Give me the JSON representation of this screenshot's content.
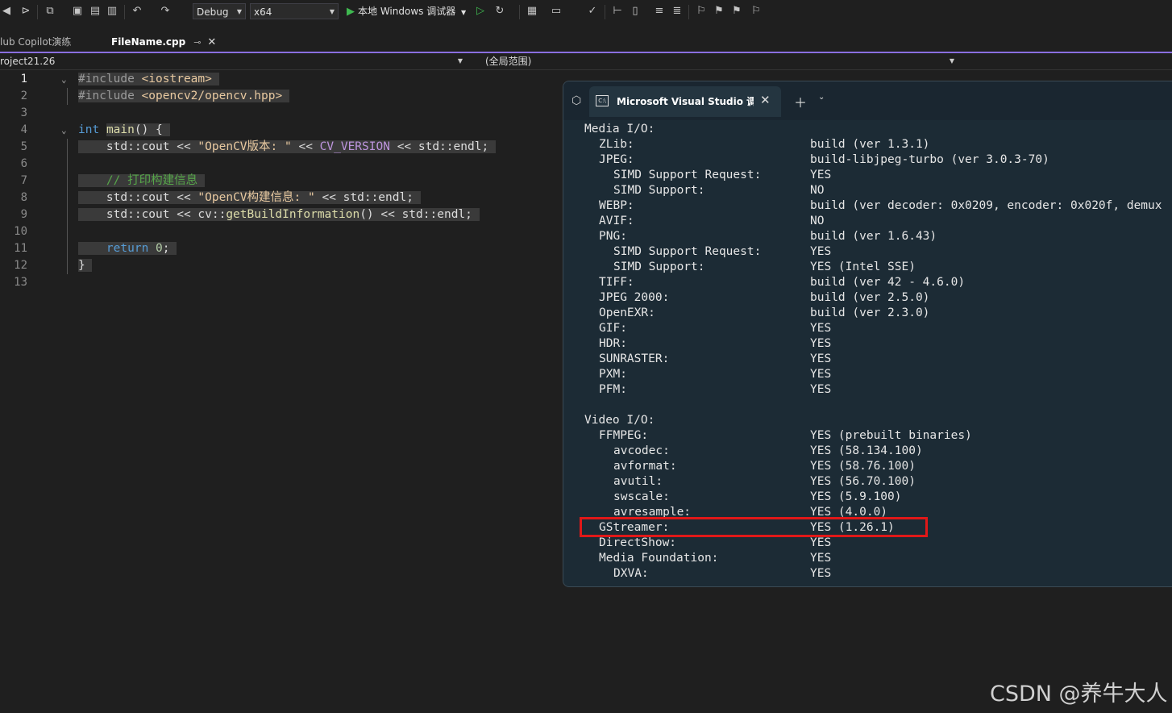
{
  "toolbar": {
    "config": "Debug",
    "platform": "x64",
    "run_label": "本地 Windows 调试器"
  },
  "tabs": [
    {
      "label": "lub Copilot演练"
    },
    {
      "label": "FileName.cpp"
    }
  ],
  "navbar": {
    "project": "roject21.26",
    "scope": "(全局范围)"
  },
  "editor": {
    "line_numbers": [
      "1",
      "2",
      "3",
      "4",
      "5",
      "6",
      "7",
      "8",
      "9",
      "10",
      "11",
      "12",
      "13"
    ],
    "lines": {
      "l1_pp": "#include",
      "l1_inc": "<iostream>",
      "l2_pp": "#include",
      "l2_inc": "<opencv2/opencv.hpp>",
      "l4_kw": "int",
      "l4_fn": "main",
      "l4_rest": "() {",
      "l5_a": "std::cout << ",
      "l5_str": "\"OpenCV版本: \"",
      "l5_b": " << ",
      "l5_mac": "CV_VERSION",
      "l5_c": " << std::endl;",
      "l7_cm": "// 打印构建信息",
      "l8_a": "std::cout << ",
      "l8_str": "\"OpenCV构建信息: \"",
      "l8_b": " << std::endl;",
      "l9_a": "std::cout << cv::",
      "l9_fn": "getBuildInformation",
      "l9_b": "() << std::endl;",
      "l11_kw": "return",
      "l11_num": "0",
      "l11_semi": ";",
      "l12": "}"
    }
  },
  "terminal": {
    "title": "Microsoft Visual Studio 调试控制台",
    "rows": [
      {
        "key": "Media I/O:",
        "value": "",
        "indent": 0
      },
      {
        "key": "ZLib:",
        "value": "build (ver 1.3.1)",
        "indent": 1
      },
      {
        "key": "JPEG:",
        "value": "build-libjpeg-turbo (ver 3.0.3-70)",
        "indent": 1
      },
      {
        "key": "SIMD Support Request:",
        "value": "YES",
        "indent": 2
      },
      {
        "key": "SIMD Support:",
        "value": "NO",
        "indent": 2
      },
      {
        "key": "WEBP:",
        "value": "build (ver decoder: 0x0209, encoder: 0x020f, demux",
        "indent": 1
      },
      {
        "key": "AVIF:",
        "value": "NO",
        "indent": 1
      },
      {
        "key": "PNG:",
        "value": "build (ver 1.6.43)",
        "indent": 1
      },
      {
        "key": "SIMD Support Request:",
        "value": "YES",
        "indent": 2
      },
      {
        "key": "SIMD Support:",
        "value": "YES (Intel SSE)",
        "indent": 2
      },
      {
        "key": "TIFF:",
        "value": "build (ver 42 - 4.6.0)",
        "indent": 1
      },
      {
        "key": "JPEG 2000:",
        "value": "build (ver 2.5.0)",
        "indent": 1
      },
      {
        "key": "OpenEXR:",
        "value": "build (ver 2.3.0)",
        "indent": 1
      },
      {
        "key": "GIF:",
        "value": "YES",
        "indent": 1
      },
      {
        "key": "HDR:",
        "value": "YES",
        "indent": 1
      },
      {
        "key": "SUNRASTER:",
        "value": "YES",
        "indent": 1
      },
      {
        "key": "PXM:",
        "value": "YES",
        "indent": 1
      },
      {
        "key": "PFM:",
        "value": "YES",
        "indent": 1
      },
      {
        "key": "",
        "value": "",
        "indent": 0
      },
      {
        "key": "Video I/O:",
        "value": "",
        "indent": 0
      },
      {
        "key": "FFMPEG:",
        "value": "YES (prebuilt binaries)",
        "indent": 1
      },
      {
        "key": "avcodec:",
        "value": "YES (58.134.100)",
        "indent": 2
      },
      {
        "key": "avformat:",
        "value": "YES (58.76.100)",
        "indent": 2
      },
      {
        "key": "avutil:",
        "value": "YES (56.70.100)",
        "indent": 2
      },
      {
        "key": "swscale:",
        "value": "YES (5.9.100)",
        "indent": 2
      },
      {
        "key": "avresample:",
        "value": "YES (4.0.0)",
        "indent": 2
      },
      {
        "key": "GStreamer:",
        "value": "YES (1.26.1)",
        "indent": 1
      },
      {
        "key": "DirectShow:",
        "value": "YES",
        "indent": 1
      },
      {
        "key": "Media Foundation:",
        "value": "YES",
        "indent": 1
      },
      {
        "key": "DXVA:",
        "value": "YES",
        "indent": 2
      }
    ]
  },
  "watermark": "CSDN @养牛大人"
}
